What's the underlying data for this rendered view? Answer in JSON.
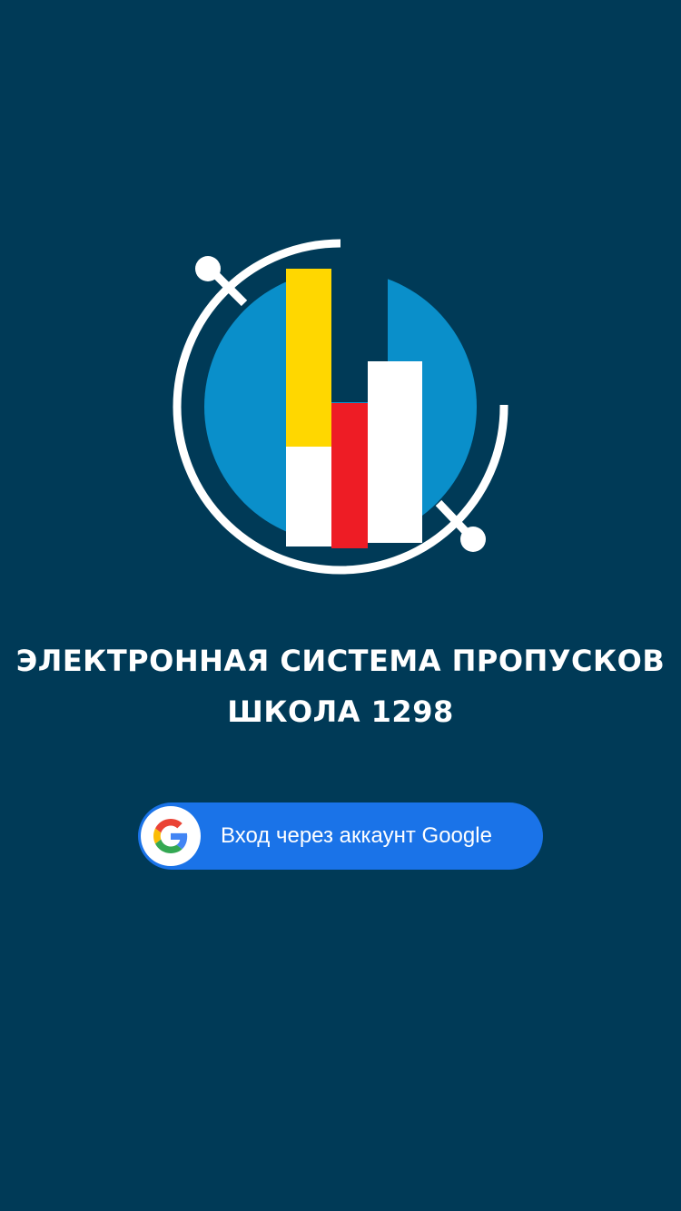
{
  "header": {
    "title_line1": "ЭЛЕКТРОННАЯ СИСТЕМА ПРОПУСКОВ",
    "title_line2": "ШКОЛА 1298"
  },
  "auth": {
    "google_button_label": "Вход через аккаунт Google",
    "icon": "google-g-icon"
  },
  "logo": {
    "icon": "school-logo-icon"
  },
  "colors": {
    "background": "#003a57",
    "button": "#1a73e8",
    "logo_blue": "#0a8fca",
    "logo_yellow": "#ffd700",
    "logo_red": "#ee1c25",
    "white": "#ffffff"
  }
}
